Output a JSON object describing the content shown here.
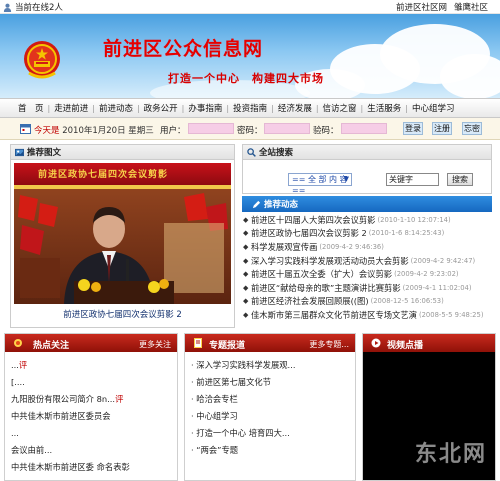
{
  "topbar": {
    "online_text": "当前在线2人",
    "community_link": "前进区社区网",
    "forum_link": "雏鹰社区"
  },
  "banner": {
    "title": "前进区公众信息网",
    "slogan": "打造一个中心　构建四大市场"
  },
  "nav": {
    "items": [
      "首　页",
      "走进前进",
      "前进动态",
      "政务公开",
      "办事指南",
      "投资指南",
      "经济发展",
      "信访之窗",
      "生活服务",
      "中心组学习"
    ]
  },
  "loginbar": {
    "today_label": "今天是",
    "date_text": "2010年1月20日 星期三",
    "user_label": "用户：",
    "password_label": "密码：",
    "captcha_label": "验码：",
    "login_btn": "登录",
    "register_btn": "注册",
    "forgot_btn": "忘密"
  },
  "photo_panel": {
    "title": "推荐图文",
    "photo_banner_text": "前进区政协七届四次会议剪影",
    "caption": "前进区政协七届四次会议剪影 2"
  },
  "search_panel": {
    "title": "全站搜索",
    "select_value": "== 全 部 内 容 ==",
    "input_value": "关键字",
    "button": "搜索"
  },
  "news_panel": {
    "title": "推荐动态",
    "items": [
      {
        "title": "前进区十四届人大第四次会议剪影",
        "date": "(2010-1-10 12:07:14)"
      },
      {
        "title": "前进区政协七届四次会议剪影 2",
        "date": "(2010-1-6 8:14:25:43)"
      },
      {
        "title": "科学发展观宣传画",
        "date": "(2009-4-2 9:46:36)"
      },
      {
        "title": "深入学习实践科学发展观活动动员大会剪影",
        "date": "(2009-4-2 9:42:47)"
      },
      {
        "title": "前进区十届五次全委（扩大）会议剪影",
        "date": "(2009-4-2 9:23:02)"
      },
      {
        "title": "前进区“献给母亲的歌”主题演讲比赛剪影",
        "date": "(2009-4-1 11:02:04)"
      },
      {
        "title": "前进区经济社会发展回顾展((图)",
        "date": "(2008-12-5 16:06:53)"
      },
      {
        "title": "佳木斯市第三届群众文化节前进区专场文艺演",
        "date": "(2008-5-5 9:48:25)"
      }
    ]
  },
  "hot_panel": {
    "title": "热点关注",
    "more": "更多关注",
    "items": [
      {
        "text": "...",
        "tag": "评"
      },
      {
        "text": "[....",
        "tag": ""
      },
      {
        "text": "九阳股份有限公司简介 8n...",
        "tag": "评"
      },
      {
        "text": "中共佳木斯市前进区委员会",
        "tag": ""
      },
      {
        "text": "...",
        "tag": ""
      },
      {
        "text": "会议由前...",
        "tag": ""
      },
      {
        "text": "中共佳木斯市前进区委  命名表彰",
        "tag": ""
      }
    ]
  },
  "topic_panel": {
    "title": "专题报道",
    "more": "更多专题...",
    "items": [
      "深入学习实践科学发展观...",
      "前进区第七届文化节",
      "哈洽会专栏",
      "中心组学习",
      "打造一个中心 培育四大...",
      "“两会”专题"
    ]
  },
  "video_panel": {
    "title": "视频点播"
  },
  "watermark": "东北网",
  "colors": {
    "banner_title": "#e60000",
    "section_head": "#b01a10",
    "news_head": "#1f78d0",
    "input_pink": "#f6cde6"
  }
}
